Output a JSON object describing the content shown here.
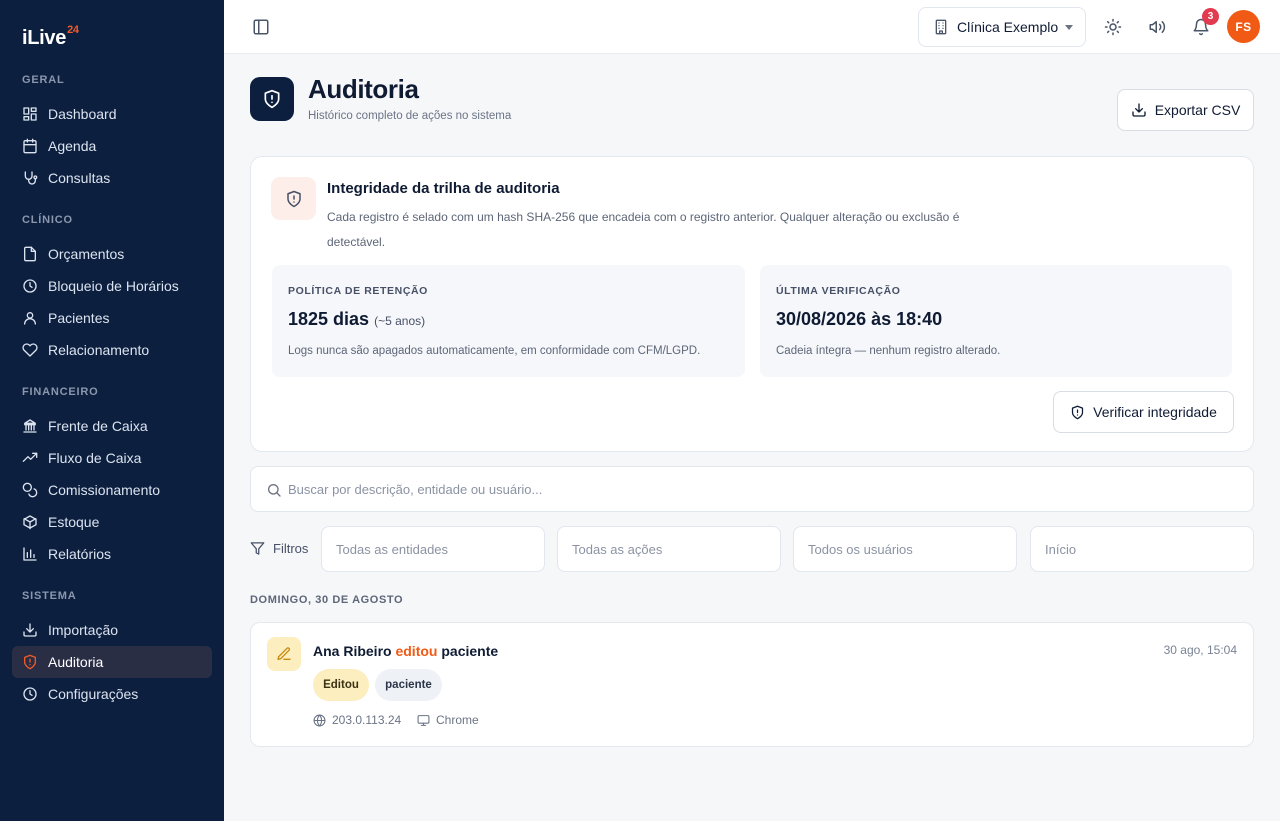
{
  "brand": {
    "name": "iLive",
    "sup": "24"
  },
  "sidebar": {
    "sections": [
      {
        "label": "GERAL",
        "items": [
          {
            "label": "Dashboard",
            "icon": "dashboard-icon"
          },
          {
            "label": "Agenda",
            "icon": "calendar-icon"
          },
          {
            "label": "Consultas",
            "icon": "stethoscope-icon"
          }
        ]
      },
      {
        "label": "CLÍNICO",
        "items": [
          {
            "label": "Orçamentos",
            "icon": "file-icon"
          },
          {
            "label": "Bloqueio de Horários",
            "icon": "clock-icon"
          },
          {
            "label": "Pacientes",
            "icon": "user-icon"
          },
          {
            "label": "Relacionamento",
            "icon": "heart-icon"
          }
        ]
      },
      {
        "label": "FINANCEIRO",
        "items": [
          {
            "label": "Frente de Caixa",
            "icon": "bank-icon"
          },
          {
            "label": "Fluxo de Caixa",
            "icon": "trending-up-icon"
          },
          {
            "label": "Comissionamento",
            "icon": "coins-icon"
          },
          {
            "label": "Estoque",
            "icon": "package-icon"
          },
          {
            "label": "Relatórios",
            "icon": "bar-chart-icon"
          }
        ]
      },
      {
        "label": "SISTEMA",
        "items": [
          {
            "label": "Importação",
            "icon": "download-icon"
          },
          {
            "label": "Auditoria",
            "icon": "shield-icon",
            "active": true
          },
          {
            "label": "Configurações",
            "icon": "clock-icon"
          }
        ]
      }
    ]
  },
  "header": {
    "clinic": "Clínica Exemplo",
    "notifications_count": "3",
    "avatar_initials": "FS"
  },
  "page": {
    "title": "Auditoria",
    "subtitle": "Histórico completo de ações no sistema",
    "export_label": "Exportar CSV"
  },
  "integrity": {
    "title": "Integridade da trilha de auditoria",
    "description": "Cada registro é selado com um hash SHA-256 que encadeia com o registro anterior. Qualquer alteração ou exclusão é detectável.",
    "retention": {
      "label": "POLÍTICA DE RETENÇÃO",
      "value": "1825 dias",
      "value_note": "(~5 anos)",
      "note": "Logs nunca são apagados automaticamente, em conformidade com CFM/LGPD."
    },
    "last_check": {
      "label": "ÚLTIMA VERIFICAÇÃO",
      "value": "30/08/2026 às 18:40",
      "note": "Cadeia íntegra — nenhum registro alterado."
    },
    "verify_label": "Verificar integridade"
  },
  "search": {
    "placeholder": "Buscar por descrição, entidade ou usuário..."
  },
  "filters": {
    "label": "Filtros",
    "entities": "Todas as entidades",
    "actions": "Todas as ações",
    "users": "Todos os usuários",
    "start": "Início"
  },
  "log": {
    "day_label": "DOMINGO, 30 DE AGOSTO",
    "events": [
      {
        "user": "Ana Ribeiro",
        "verb": "editou",
        "entity": "paciente",
        "time": "30 ago, 15:04",
        "action_chip": "Editou",
        "entity_chip": "paciente",
        "ip": "203.0.113.24",
        "browser": "Chrome"
      }
    ]
  },
  "colors": {
    "sidebar_bg": "#0d1f3f",
    "accent": "#f05a14",
    "badge": "#e23a4e"
  }
}
